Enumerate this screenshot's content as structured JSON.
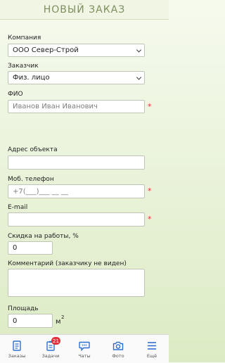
{
  "header": {
    "title": "НОВЫЙ ЗАКАЗ"
  },
  "form": {
    "company": {
      "label": "Компания",
      "value": "ООО Север-Строй"
    },
    "customer": {
      "label": "Заказчик",
      "value": "Физ. лицо"
    },
    "fio": {
      "label": "ФИО",
      "placeholder": "Иванов Иван Иванович",
      "required": "*"
    },
    "address": {
      "label": "Адрес объекта",
      "value": ""
    },
    "phone": {
      "label": "Моб. телефон",
      "placeholder": "+7(___)___ __ __",
      "required": "*"
    },
    "email": {
      "label": "E-mail",
      "value": "",
      "required": "*"
    },
    "discount": {
      "label": "Скидка на работы, %",
      "value": "0"
    },
    "comment": {
      "label": "Комментарий (заказчику не виден)",
      "value": ""
    },
    "area": {
      "label": "Площадь",
      "value": "0",
      "unit": "м",
      "unit_sup": "2"
    }
  },
  "tabbar": {
    "accent": "#2f6fd0",
    "items": [
      {
        "label": "Заказы",
        "icon": "orders-icon"
      },
      {
        "label": "Задачи",
        "icon": "tasks-icon",
        "badge": "21"
      },
      {
        "label": "Чаты",
        "icon": "chat-icon"
      },
      {
        "label": "Фото",
        "icon": "camera-icon"
      },
      {
        "label": "Ещё",
        "icon": "menu-icon"
      }
    ]
  }
}
